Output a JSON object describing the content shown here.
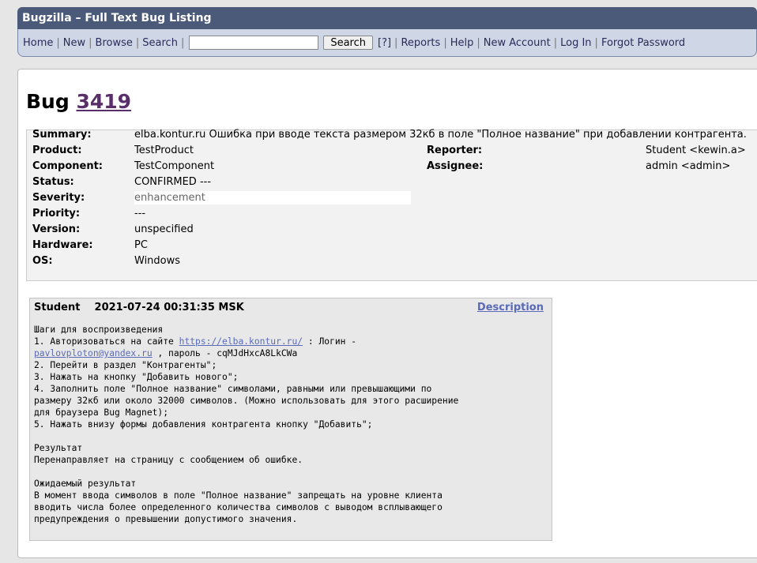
{
  "title": "Bugzilla – Full Text Bug Listing",
  "nav": {
    "links_left": [
      "Home",
      "New",
      "Browse",
      "Search"
    ],
    "search_value": "",
    "search_button": "Search",
    "help_link": "[?]",
    "links_right": [
      "Reports",
      "Help",
      "New Account",
      "Log In",
      "Forgot Password"
    ]
  },
  "bug": {
    "prefix": "Bug",
    "id": "3419"
  },
  "fields": {
    "summary": {
      "label": "Summary:",
      "value": "elba.kontur.ru Ошибка при вводе текста размером 32кб в поле \"Полное название\" при добавлении контрагента."
    },
    "product": {
      "label": "Product:",
      "value": "TestProduct"
    },
    "component": {
      "label": "Component:",
      "value": "TestComponent"
    },
    "status": {
      "label": "Status:",
      "value": "CONFIRMED ---"
    },
    "severity": {
      "label": "Severity:",
      "value": "enhancement"
    },
    "priority": {
      "label": "Priority:",
      "value": "---"
    },
    "version": {
      "label": "Version:",
      "value": "unspecified"
    },
    "hardware": {
      "label": "Hardware:",
      "value": "PC"
    },
    "os": {
      "label": "OS:",
      "value": "Windows"
    },
    "reporter": {
      "label": "Reporter:",
      "value": "Student <kewin.a>"
    },
    "assignee": {
      "label": "Assignee:",
      "value": "admin <admin>"
    }
  },
  "comment": {
    "author": "Student",
    "timestamp": "2021-07-24 00:31:35 MSK",
    "description_link": "Description",
    "lines": {
      "l1": "Шаги для воспроизведения",
      "l2a": "1. Авторизоваться на сайте ",
      "l2link": "https://elba.kontur.ru/",
      "l2b": " : Логин -",
      "l3link": "pavlovploton@yandex.ru",
      "l3b": " , пароль - cqMJdHxcA8LkCWa",
      "l4": "2. Перейти в раздел \"Контрагенты\";",
      "l5": "3. Нажать на кнопку \"Добавить нового\";",
      "l6": "4. Заполнить поле \"Полное название\" символами, равными или превышающими по",
      "l7": "размеру 32кб или около 32000 символов. (Можно использовать для этого расширение",
      "l8": "для браузера Bug Magnet);",
      "l9": "5. Нажать внизу формы добавления контрагента кнопку \"Добавить\";",
      "l10": "Результат",
      "l11": "Перенаправляет на страницу с сообщением об ошибке.",
      "l12": "Ожидаемый результат",
      "l13": "В момент ввода символов в поле \"Полное название\" запрещать на уровне клиента",
      "l14": "вводить числа более определенного количества символов с выводом всплывающего",
      "l15": "предупреждения о превышении допустимого значения."
    }
  }
}
